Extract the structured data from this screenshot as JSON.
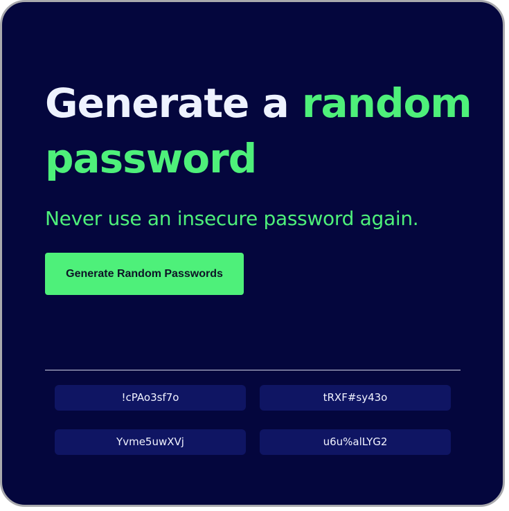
{
  "hero": {
    "title_prefix": "Generate a ",
    "title_accent": "random password",
    "subtitle": "Never use an insecure password again."
  },
  "button": {
    "label": "Generate Random Passwords"
  },
  "passwords": [
    "!cPAo3sf7o",
    "tRXF#sy43o",
    "Yvme5uwXVj",
    "u6u%alLYG2"
  ],
  "colors": {
    "background": "#04063d",
    "accent": "#4ef07a",
    "title_text": "#eef2ff",
    "password_box": "#0f1563",
    "frame_border": "#a9a9ad"
  }
}
